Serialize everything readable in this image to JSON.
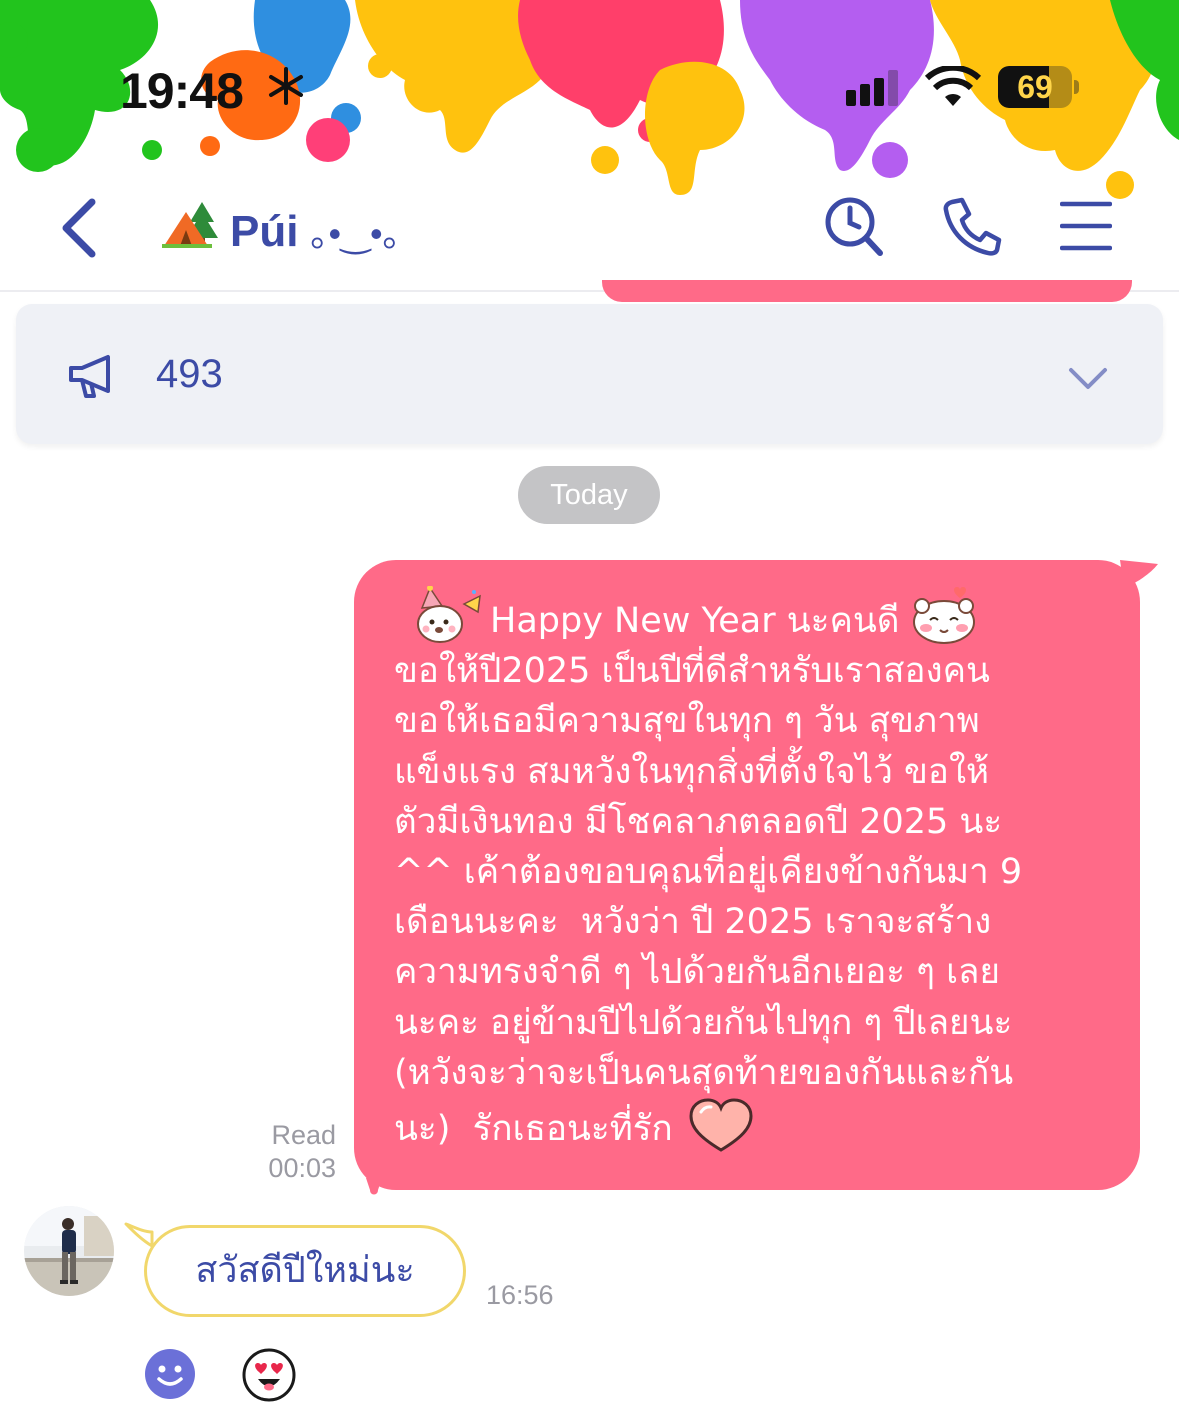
{
  "status_bar": {
    "time": "19:48",
    "battery": "69",
    "battery_level": 0.69
  },
  "chat_header": {
    "back_icon": "chevron-left-icon",
    "avatar_emoji": "⛺",
    "title": "Púi",
    "title_decoration": "｡•‿•｡",
    "search_icon": "search-icon",
    "call_icon": "phone-icon",
    "menu_icon": "menu-icon"
  },
  "announcement": {
    "icon": "megaphone-icon",
    "count": "493"
  },
  "date_separator": "Today",
  "messages": {
    "outgoing": {
      "line1": "Happy New Year นะคนดี",
      "body": "ขอให้ปี2025 เป็นปีที่ดีสำหรับเราสองคน\nขอให้เธอมีความสุขในทุก ๆ วัน สุขภาพ\nแข็งแรง สมหวังในทุกสิ่งที่ตั้งใจไว้ ขอให้\nตัวมีเงินทอง มีโชคลาภตลอดปี 2025 นะ\n^^ เค้าต้องขอบคุณที่อยู่เคียงข้างกันมา 9\nเดือนนะคะ  หวังว่า ปี 2025 เราจะสร้าง\nความทรงจำดี ๆ ไปด้วยกันอีกเยอะ ๆ เลย\nนะคะ อยู่ข้ามปีไปด้วยกันไปทุก ๆ ปีเลยนะ\n(หวังจะว่าจะเป็นคนสุดท้ายของกันและกัน\n",
      "last_line": "นะ)  รักเธอนะที่รัก",
      "read_label": "Read",
      "read_time": "00:03",
      "bubble_color": "#ff6a88"
    },
    "incoming": {
      "text": "สวัสดีปีใหม่นะ",
      "time": "16:56",
      "border_color": "#f1d76b"
    }
  },
  "reactions": {
    "smile_icon": "smile-icon",
    "love_icon": "heart-eyes-icon"
  },
  "colors": {
    "accent": "#3c4ba6",
    "outgoing_bubble": "#ff6a88",
    "background": "#ffffff"
  }
}
